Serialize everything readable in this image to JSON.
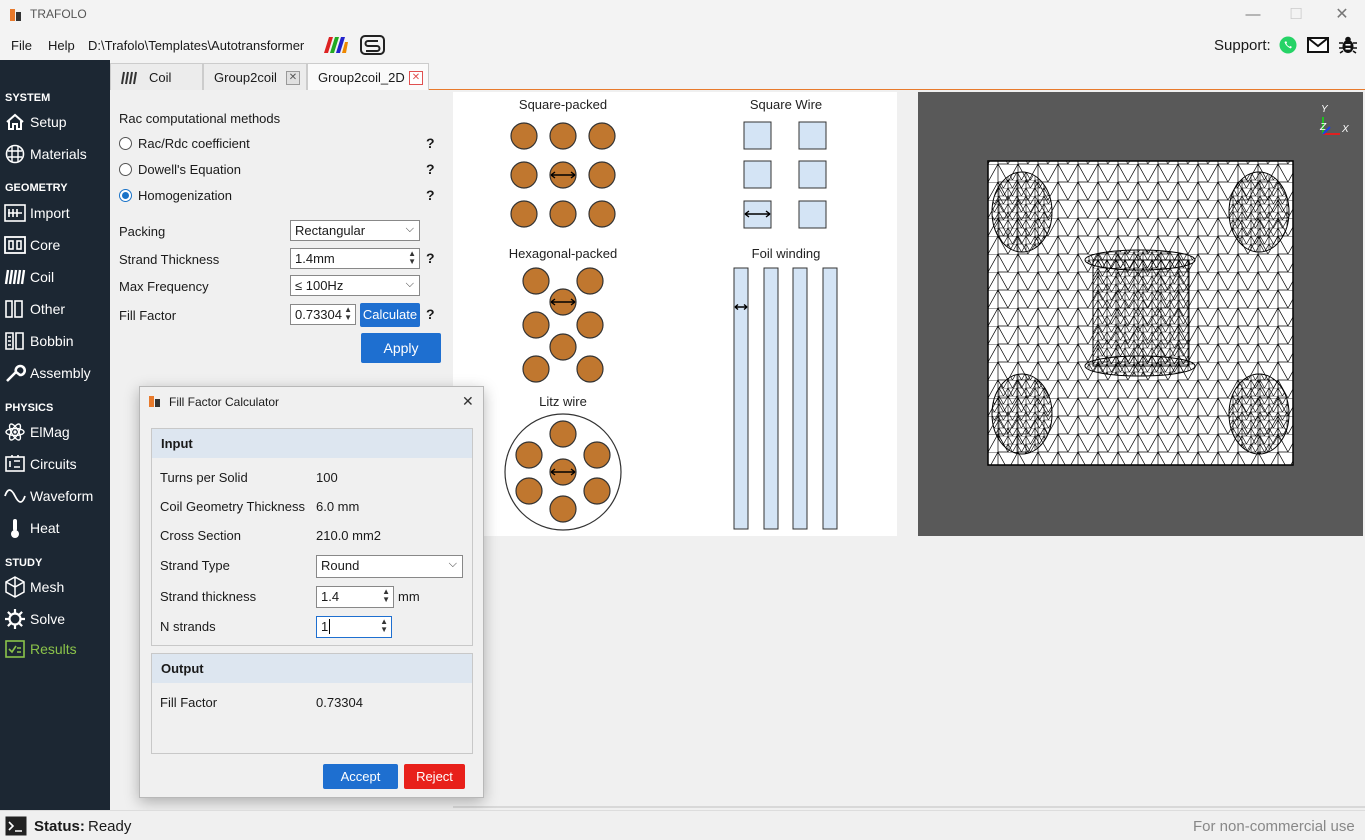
{
  "window": {
    "title": "TRAFOLO",
    "minimize": "—",
    "maximize": "☐",
    "close": "✕"
  },
  "menu": {
    "file": "File",
    "help": "Help",
    "path": "D:\\Trafolo\\Templates\\Autotransformer",
    "support": "Support:"
  },
  "sidebar": {
    "sections": [
      "SYSTEM",
      "GEOMETRY",
      "PHYSICS",
      "STUDY"
    ],
    "items": [
      "Setup",
      "Materials",
      "Import",
      "Core",
      "Coil",
      "Other",
      "Bobbin",
      "Assembly",
      "ElMag",
      "Circuits",
      "Waveform",
      "Heat",
      "Mesh",
      "Solve",
      "Results"
    ],
    "active": "Results"
  },
  "tabs": [
    {
      "label": "Coil"
    },
    {
      "label": "Group2coil"
    },
    {
      "label": "Group2coil_2D"
    }
  ],
  "coil_settings": {
    "section_title": "Rac computational methods",
    "methods": [
      "Rac/Rdc coefficient",
      "Dowell's Equation",
      "Homogenization"
    ],
    "selected_method": "Homogenization",
    "help": "?",
    "packing_label": "Packing",
    "packing_value": "Rectangular",
    "strand_thickness_label": "Strand Thickness",
    "strand_thickness_value": "1.4mm",
    "max_frequency_label": "Max Frequency",
    "max_frequency_value": "≤ 100Hz",
    "fill_factor_label": "Fill Factor",
    "fill_factor_value": "0.73304",
    "calculate_label": "Calculate",
    "apply_label": "Apply"
  },
  "illustration": {
    "square_packed": "Square-packed",
    "square_wire": "Square Wire",
    "hexagonal_packed": "Hexagonal-packed",
    "foil_winding": "Foil winding",
    "litz_wire": "Litz wire"
  },
  "mesh_view": {
    "axis_y": "Y",
    "axis_z": "Z",
    "axis_x": "X"
  },
  "dialog": {
    "title": "Fill Factor Calculator",
    "close": "✕",
    "input_header": "Input",
    "turns_label": "Turns per Solid",
    "turns_value": "100",
    "geom_label": "Coil Geometry Thickness",
    "geom_value": "6.0 mm",
    "cross_label": "Cross Section",
    "cross_value": "210.0 mm2",
    "strand_type_label": "Strand Type",
    "strand_type_value": "Round",
    "strand_thickness_label": "Strand thickness",
    "strand_thickness_value": "1.4",
    "strand_thickness_unit": "mm",
    "nstrands_label": "N strands",
    "nstrands_value": "1",
    "output_header": "Output",
    "fill_label": "Fill Factor",
    "fill_value": "0.73304",
    "accept": "Accept",
    "reject": "Reject"
  },
  "status": {
    "label": "Status:",
    "value": "Ready",
    "license": "For non-commercial use"
  },
  "colors": {
    "accent": "#1e6fd0",
    "sidebar_bg": "#1c2733",
    "conductor": "#c0772f",
    "square_fill": "#d4e4f5",
    "results_green": "#8bc34a",
    "reject": "#e8201a"
  }
}
